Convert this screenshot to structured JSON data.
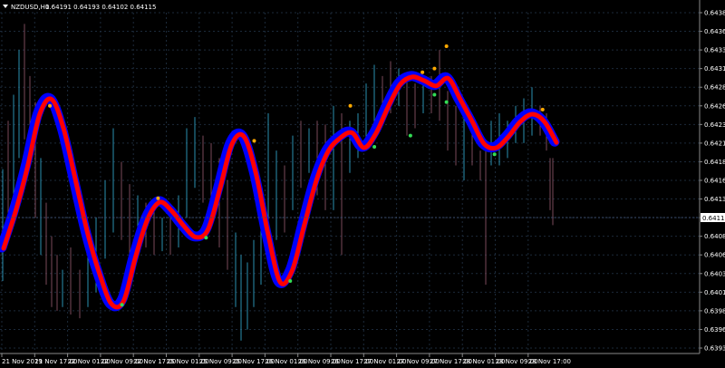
{
  "header": {
    "symbol_label": "NZDUSD,H1",
    "ohlc_label": "0.64191 0.64193 0.64102 0.64115"
  },
  "colors": {
    "background": "#000000",
    "grid": "#1c2a3a",
    "axis": "#8a8a8a",
    "band_outer": "#0000ff",
    "band_inner": "#ff0000",
    "candle_up": "#2a8fb0",
    "candle_down": "#7a4a5a",
    "signal_buy": "#33dd55",
    "signal_sell": "#ffaa00",
    "price_box": "#ffffff"
  },
  "icons": {
    "menu": "triangle-down-icon"
  },
  "chart_data": {
    "type": "line",
    "ylim": [
      0.63935,
      0.64385
    ],
    "yticks": [
      "0.64385",
      "0.64360",
      "0.64335",
      "0.64310",
      "0.64285",
      "0.64260",
      "0.64235",
      "0.64210",
      "0.64185",
      "0.64160",
      "0.64135",
      "0.64110",
      "0.64085",
      "0.64060",
      "0.64035",
      "0.64010",
      "0.63985",
      "0.63960",
      "0.63935"
    ],
    "xticks": [
      "21 Nov 2019",
      "21 Nov 17:00",
      "22 Nov 01:00",
      "22 Nov 09:00",
      "22 Nov 17:00",
      "25 Nov 01:00",
      "25 Nov 09:00",
      "25 Nov 17:00",
      "26 Nov 01:00",
      "26 Nov 09:00",
      "26 Nov 17:00",
      "27 Nov 01:00",
      "27 Nov 09:00",
      "27 Nov 17:00",
      "28 Nov 01:00",
      "28 Nov 09:00",
      "28 Nov 17:00"
    ],
    "current_price": "0.64115",
    "series": [
      {
        "values": [
          0.6407,
          0.6412,
          0.6418,
          0.6425,
          0.6427,
          0.6423,
          0.6416,
          0.6409,
          0.64035,
          0.63995,
          0.64,
          0.6406,
          0.6411,
          0.64132,
          0.6412,
          0.641,
          0.64085,
          0.64095,
          0.6415,
          0.6421,
          0.6422,
          0.6417,
          0.6409,
          0.64025,
          0.6404,
          0.641,
          0.6416,
          0.642,
          0.64218,
          0.64225,
          0.64205,
          0.64225,
          0.6426,
          0.6429,
          0.643,
          0.64295,
          0.64288,
          0.64298,
          0.6427,
          0.6424,
          0.6421,
          0.64205,
          0.6422,
          0.6424,
          0.6425,
          0.6424,
          0.64212
        ]
      }
    ],
    "candles": [
      {
        "x": 3,
        "h": 0.64175,
        "l": 0.64025,
        "c": "up"
      },
      {
        "x": 9,
        "h": 0.6424,
        "l": 0.64085,
        "c": "down"
      },
      {
        "x": 15,
        "h": 0.64275,
        "l": 0.6414,
        "c": "up"
      },
      {
        "x": 21,
        "h": 0.64335,
        "l": 0.6419,
        "c": "up"
      },
      {
        "x": 27,
        "h": 0.6437,
        "l": 0.64215,
        "c": "down"
      },
      {
        "x": 33,
        "h": 0.643,
        "l": 0.6418,
        "c": "down"
      },
      {
        "x": 39,
        "h": 0.64265,
        "l": 0.6411,
        "c": "down"
      },
      {
        "x": 45,
        "h": 0.6419,
        "l": 0.6406,
        "c": "up"
      },
      {
        "x": 51,
        "h": 0.6413,
        "l": 0.6402,
        "c": "down"
      },
      {
        "x": 57,
        "h": 0.64085,
        "l": 0.6399,
        "c": "down"
      },
      {
        "x": 63,
        "h": 0.6406,
        "l": 0.63985,
        "c": "down"
      },
      {
        "x": 69,
        "h": 0.6404,
        "l": 0.6399,
        "c": "up"
      },
      {
        "x": 78,
        "h": 0.6407,
        "l": 0.6398,
        "c": "down"
      },
      {
        "x": 88,
        "h": 0.6404,
        "l": 0.63975,
        "c": "down"
      },
      {
        "x": 97,
        "h": 0.6406,
        "l": 0.6399,
        "c": "up"
      },
      {
        "x": 106,
        "h": 0.6411,
        "l": 0.6401,
        "c": "up"
      },
      {
        "x": 116,
        "h": 0.6416,
        "l": 0.64055,
        "c": "up"
      },
      {
        "x": 125,
        "h": 0.6423,
        "l": 0.6409,
        "c": "up"
      },
      {
        "x": 134,
        "h": 0.64185,
        "l": 0.6408,
        "c": "down"
      },
      {
        "x": 143,
        "h": 0.64155,
        "l": 0.6406,
        "c": "down"
      },
      {
        "x": 152,
        "h": 0.6414,
        "l": 0.6408,
        "c": "up"
      },
      {
        "x": 161,
        "h": 0.6413,
        "l": 0.6407,
        "c": "down"
      },
      {
        "x": 170,
        "h": 0.6412,
        "l": 0.6406,
        "c": "down"
      },
      {
        "x": 179,
        "h": 0.6411,
        "l": 0.64065,
        "c": "up"
      },
      {
        "x": 188,
        "h": 0.6411,
        "l": 0.6406,
        "c": "down"
      },
      {
        "x": 197,
        "h": 0.6414,
        "l": 0.6407,
        "c": "up"
      },
      {
        "x": 206,
        "h": 0.6423,
        "l": 0.6411,
        "c": "up"
      },
      {
        "x": 215,
        "h": 0.64245,
        "l": 0.6415,
        "c": "up"
      },
      {
        "x": 224,
        "h": 0.6422,
        "l": 0.6413,
        "c": "down"
      },
      {
        "x": 233,
        "h": 0.6421,
        "l": 0.6411,
        "c": "down"
      },
      {
        "x": 242,
        "h": 0.6419,
        "l": 0.6407,
        "c": "down"
      },
      {
        "x": 251,
        "h": 0.6416,
        "l": 0.6404,
        "c": "down"
      },
      {
        "x": 260,
        "h": 0.6409,
        "l": 0.6399,
        "c": "up"
      },
      {
        "x": 266,
        "h": 0.6406,
        "l": 0.63945,
        "c": "up"
      },
      {
        "x": 273,
        "h": 0.6405,
        "l": 0.6396,
        "c": "up"
      },
      {
        "x": 280,
        "h": 0.6408,
        "l": 0.6399,
        "c": "up"
      },
      {
        "x": 288,
        "h": 0.6413,
        "l": 0.6402,
        "c": "up"
      },
      {
        "x": 296,
        "h": 0.6425,
        "l": 0.6406,
        "c": "up"
      },
      {
        "x": 305,
        "h": 0.642,
        "l": 0.6408,
        "c": "up"
      },
      {
        "x": 314,
        "h": 0.6418,
        "l": 0.6409,
        "c": "down"
      },
      {
        "x": 323,
        "h": 0.6422,
        "l": 0.6412,
        "c": "up"
      },
      {
        "x": 332,
        "h": 0.6424,
        "l": 0.6415,
        "c": "down"
      },
      {
        "x": 341,
        "h": 0.6423,
        "l": 0.6417,
        "c": "up"
      },
      {
        "x": 350,
        "h": 0.6424,
        "l": 0.6414,
        "c": "down"
      },
      {
        "x": 359,
        "h": 0.64235,
        "l": 0.6412,
        "c": "down"
      },
      {
        "x": 368,
        "h": 0.6426,
        "l": 0.6412,
        "c": "up"
      },
      {
        "x": 377,
        "h": 0.6425,
        "l": 0.6406,
        "c": "down"
      },
      {
        "x": 386,
        "h": 0.6424,
        "l": 0.6417,
        "c": "up"
      },
      {
        "x": 395,
        "h": 0.6425,
        "l": 0.6419,
        "c": "up"
      },
      {
        "x": 404,
        "h": 0.6429,
        "l": 0.642,
        "c": "up"
      },
      {
        "x": 413,
        "h": 0.64315,
        "l": 0.6423,
        "c": "up"
      },
      {
        "x": 422,
        "h": 0.643,
        "l": 0.6424,
        "c": "down"
      },
      {
        "x": 431,
        "h": 0.6432,
        "l": 0.6425,
        "c": "down"
      },
      {
        "x": 440,
        "h": 0.6431,
        "l": 0.6426,
        "c": "up"
      },
      {
        "x": 449,
        "h": 0.643,
        "l": 0.6422,
        "c": "down"
      },
      {
        "x": 458,
        "h": 0.6429,
        "l": 0.6423,
        "c": "down"
      },
      {
        "x": 467,
        "h": 0.6429,
        "l": 0.6425,
        "c": "up"
      },
      {
        "x": 476,
        "h": 0.643,
        "l": 0.6425,
        "c": "down"
      },
      {
        "x": 485,
        "h": 0.64335,
        "l": 0.6424,
        "c": "down"
      },
      {
        "x": 494,
        "h": 0.6428,
        "l": 0.642,
        "c": "down"
      },
      {
        "x": 503,
        "h": 0.6426,
        "l": 0.6418,
        "c": "down"
      },
      {
        "x": 512,
        "h": 0.6425,
        "l": 0.6416,
        "c": "up"
      },
      {
        "x": 521,
        "h": 0.6423,
        "l": 0.6418,
        "c": "down"
      },
      {
        "x": 530,
        "h": 0.642,
        "l": 0.6416,
        "c": "down"
      },
      {
        "x": 536,
        "h": 0.6421,
        "l": 0.6402,
        "c": "down"
      },
      {
        "x": 542,
        "h": 0.6424,
        "l": 0.6418,
        "c": "up"
      },
      {
        "x": 551,
        "h": 0.6425,
        "l": 0.6418,
        "c": "up"
      },
      {
        "x": 560,
        "h": 0.6424,
        "l": 0.6419,
        "c": "up"
      },
      {
        "x": 569,
        "h": 0.6426,
        "l": 0.6421,
        "c": "up"
      },
      {
        "x": 578,
        "h": 0.6427,
        "l": 0.6421,
        "c": "up"
      },
      {
        "x": 587,
        "h": 0.64285,
        "l": 0.6422,
        "c": "up"
      },
      {
        "x": 596,
        "h": 0.6426,
        "l": 0.6422,
        "c": "down"
      },
      {
        "x": 603,
        "h": 0.6425,
        "l": 0.642,
        "c": "down"
      },
      {
        "x": 607,
        "h": 0.6419,
        "l": 0.6412,
        "c": "down"
      },
      {
        "x": 610,
        "h": 0.6419,
        "l": 0.641,
        "c": "down"
      }
    ],
    "signals": [
      {
        "i": 4,
        "y": 0.6426,
        "kind": "sell"
      },
      {
        "i": 10,
        "y": 0.63993,
        "kind": "buy"
      },
      {
        "i": 13,
        "y": 0.64136,
        "kind": "sell"
      },
      {
        "i": 17,
        "y": 0.64083,
        "kind": "buy"
      },
      {
        "i": 21,
        "y": 0.64213,
        "kind": "sell"
      },
      {
        "i": 24,
        "y": 0.64025,
        "kind": "buy"
      },
      {
        "i": 29,
        "y": 0.6426,
        "kind": "sell"
      },
      {
        "i": 31,
        "y": 0.64205,
        "kind": "buy"
      },
      {
        "i": 35,
        "y": 0.64305,
        "kind": "sell"
      },
      {
        "i": 36,
        "y": 0.6431,
        "kind": "sell"
      },
      {
        "i": 37,
        "y": 0.6434,
        "kind": "sell"
      },
      {
        "i": 36,
        "y": 0.64275,
        "kind": "buy"
      },
      {
        "i": 37,
        "y": 0.64265,
        "kind": "buy"
      },
      {
        "i": 34,
        "y": 0.6422,
        "kind": "buy"
      },
      {
        "i": 41,
        "y": 0.64195,
        "kind": "buy"
      },
      {
        "i": 45,
        "y": 0.64255,
        "kind": "sell"
      }
    ]
  }
}
